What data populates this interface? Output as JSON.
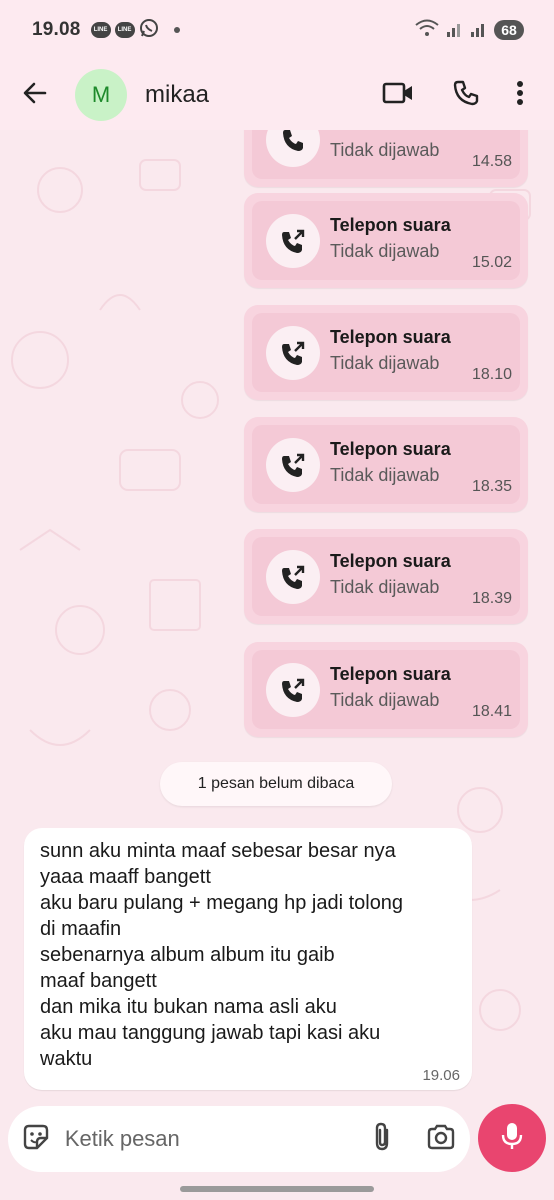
{
  "status_bar": {
    "time": "19.08",
    "badges": [
      "LINE",
      "LINE"
    ],
    "icons": [
      "line-icon",
      "line-icon",
      "whatsapp-icon",
      "dot-icon",
      "wifi-icon",
      "signal-icon",
      "signal-icon"
    ],
    "battery": "68"
  },
  "header": {
    "avatar_letter": "M",
    "contact_name": "mikaa",
    "icons": [
      "back-arrow-icon",
      "video-call-icon",
      "voice-call-icon",
      "more-vert-icon"
    ]
  },
  "calls": [
    {
      "title": "",
      "status": "Tidak dijawab",
      "time": "14.58"
    },
    {
      "title": "Telepon suara",
      "status": "Tidak dijawab",
      "time": "15.02"
    },
    {
      "title": "Telepon suara",
      "status": "Tidak dijawab",
      "time": "18.10"
    },
    {
      "title": "Telepon suara",
      "status": "Tidak dijawab",
      "time": "18.35"
    },
    {
      "title": "Telepon suara",
      "status": "Tidak dijawab",
      "time": "18.39"
    },
    {
      "title": "Telepon suara",
      "status": "Tidak dijawab",
      "time": "18.41"
    }
  ],
  "unread_label": "1 pesan belum dibaca",
  "message": {
    "lines": [
      "sunn aku minta maaf sebesar besar nya",
      "yaaa maaff bangett",
      "aku baru pulang + megang hp jadi tolong",
      "di maafin",
      "sebenarnya album album itu gaib",
      "maaf bangett",
      "dan mika itu bukan nama asli aku",
      "aku mau tanggung jawab tapi kasi aku",
      "waktu"
    ],
    "time": "19.06"
  },
  "input": {
    "placeholder": "Ketik pesan"
  },
  "colors": {
    "background": "#fae9ee",
    "call_bubble": "#f8d4df",
    "mic_button": "#e9456f",
    "avatar_bg": "#c9f2c7"
  }
}
